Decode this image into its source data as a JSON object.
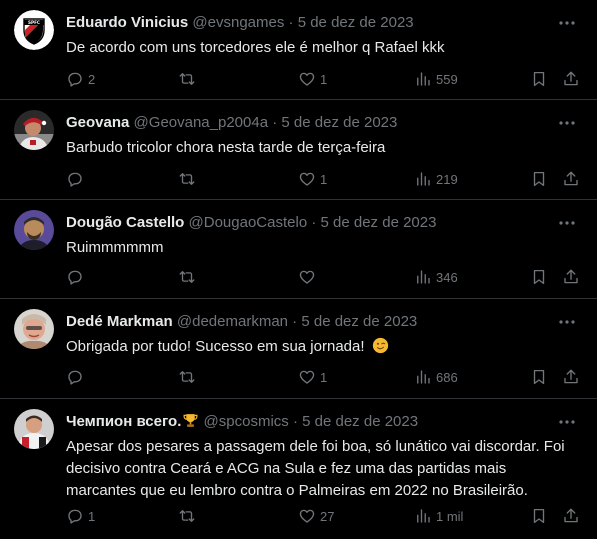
{
  "tweets": [
    {
      "name": "Eduardo Vinicius",
      "handle": "@evsngames",
      "separator": "·",
      "date": "5 de dez de 2023",
      "text": "De acordo com uns torcedores  ele é melhor q Rafael kkk",
      "replies": "2",
      "retweets": "",
      "likes": "1",
      "views": "559",
      "avatar_icon": "spfc-crest-avatar",
      "avatar_text": "SPFC"
    },
    {
      "name": "Geovana",
      "handle": "@Geovana_p2004a",
      "separator": "·",
      "date": "5 de dez de 2023",
      "text": "Barbudo tricolor chora nesta tarde de terça-feira",
      "replies": "",
      "retweets": "",
      "likes": "1",
      "views": "219",
      "avatar_icon": "photo-avatar"
    },
    {
      "name": "Dougão Castello",
      "handle": "@DougaoCastelo",
      "separator": "·",
      "date": "5 de dez de 2023",
      "text": "Ruimmmmmm",
      "replies": "",
      "retweets": "",
      "likes": "",
      "views": "346",
      "avatar_icon": "photo-avatar"
    },
    {
      "name": "Dedé Markman",
      "handle": "@dedemarkman",
      "separator": "·",
      "date": "5 de dez de 2023",
      "text": "Obrigada por tudo! Sucesso em sua jornada!",
      "emoji": "wink-emoji",
      "replies": "",
      "retweets": "",
      "likes": "1",
      "views": "686",
      "avatar_icon": "photo-avatar"
    },
    {
      "name": "Чемпион всего.",
      "name_emoji": "trophy-emoji",
      "handle": "@spcosmics",
      "separator": "·",
      "date": "5 de dez de 2023",
      "text": "Apesar dos pesares a passagem dele foi boa, só lunático vai discordar. Foi decisivo contra Ceará e ACG na Sula e fez uma das partidas mais marcantes que eu lembro contra o Palmeiras em 2022 no Brasileirão.",
      "replies": "1",
      "retweets": "",
      "likes": "27",
      "views": "1 mil",
      "avatar_icon": "photo-avatar"
    }
  ],
  "colors": {
    "background": "#000000",
    "text_primary": "#e7e9ea",
    "text_secondary": "#71767b",
    "divider": "#2f3336"
  }
}
